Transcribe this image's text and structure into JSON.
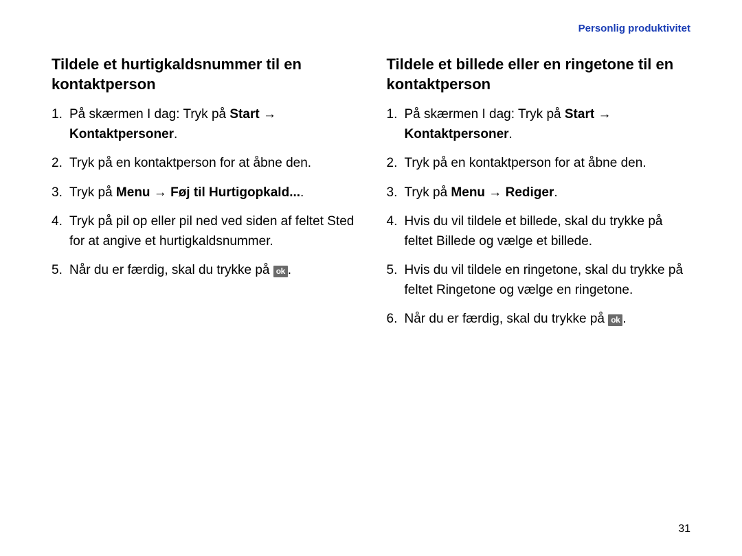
{
  "header": {
    "section_label": "Personlig produktivitet"
  },
  "left": {
    "heading": "Tildele et hurtigkaldsnummer til en kontaktperson",
    "steps": [
      {
        "num": "1.",
        "pre": "På skærmen I dag: Tryk på ",
        "bold1": "Start",
        "arrow1": " → ",
        "bold2": "Kontaktpersoner",
        "post": "."
      },
      {
        "num": "2.",
        "text": "Tryk på en kontaktperson for at åbne den."
      },
      {
        "num": "3.",
        "pre": "Tryk på ",
        "bold1": "Menu",
        "arrow1": " → ",
        "bold2": "Føj til Hurtigopkald...",
        "post": "."
      },
      {
        "num": "4.",
        "text": "Tryk på pil op eller pil ned ved siden af feltet Sted for at angive et hurtigkaldsnummer."
      },
      {
        "num": "5.",
        "text_pre": "Når du er færdig, skal du trykke på ",
        "ok": "ok",
        "text_post": "."
      }
    ]
  },
  "right": {
    "heading": "Tildele et billede eller en ringetone til en kontaktperson",
    "steps": [
      {
        "num": "1.",
        "pre": "På skærmen I dag: Tryk på ",
        "bold1": "Start",
        "arrow1": " → ",
        "bold2": "Kontaktpersoner",
        "post": "."
      },
      {
        "num": "2.",
        "text": "Tryk på en kontaktperson for at åbne den."
      },
      {
        "num": "3.",
        "pre": "Tryk på ",
        "bold1": "Menu",
        "arrow1": " → ",
        "bold2": "Rediger",
        "post": "."
      },
      {
        "num": "4.",
        "text": "Hvis du vil tildele et billede, skal du trykke på feltet Billede og vælge et billede."
      },
      {
        "num": "5.",
        "text": "Hvis du vil tildele en ringetone, skal du trykke på feltet Ringetone og vælge en ringetone."
      },
      {
        "num": "6.",
        "text_pre": "Når du er færdig, skal du trykke på ",
        "ok": "ok",
        "text_post": "."
      }
    ]
  },
  "page_number": "31"
}
